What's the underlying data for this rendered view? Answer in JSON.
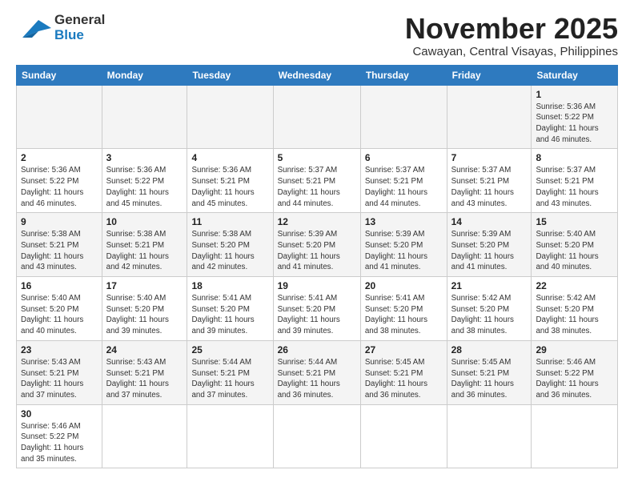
{
  "header": {
    "logo_line1": "General",
    "logo_line2": "Blue",
    "month_title": "November 2025",
    "location": "Cawayan, Central Visayas, Philippines"
  },
  "weekdays": [
    "Sunday",
    "Monday",
    "Tuesday",
    "Wednesday",
    "Thursday",
    "Friday",
    "Saturday"
  ],
  "weeks": [
    [
      {
        "day": "",
        "info": ""
      },
      {
        "day": "",
        "info": ""
      },
      {
        "day": "",
        "info": ""
      },
      {
        "day": "",
        "info": ""
      },
      {
        "day": "",
        "info": ""
      },
      {
        "day": "",
        "info": ""
      },
      {
        "day": "1",
        "info": "Sunrise: 5:36 AM\nSunset: 5:22 PM\nDaylight: 11 hours\nand 46 minutes."
      }
    ],
    [
      {
        "day": "2",
        "info": "Sunrise: 5:36 AM\nSunset: 5:22 PM\nDaylight: 11 hours\nand 46 minutes."
      },
      {
        "day": "3",
        "info": "Sunrise: 5:36 AM\nSunset: 5:22 PM\nDaylight: 11 hours\nand 45 minutes."
      },
      {
        "day": "4",
        "info": "Sunrise: 5:36 AM\nSunset: 5:21 PM\nDaylight: 11 hours\nand 45 minutes."
      },
      {
        "day": "5",
        "info": "Sunrise: 5:37 AM\nSunset: 5:21 PM\nDaylight: 11 hours\nand 44 minutes."
      },
      {
        "day": "6",
        "info": "Sunrise: 5:37 AM\nSunset: 5:21 PM\nDaylight: 11 hours\nand 44 minutes."
      },
      {
        "day": "7",
        "info": "Sunrise: 5:37 AM\nSunset: 5:21 PM\nDaylight: 11 hours\nand 43 minutes."
      },
      {
        "day": "8",
        "info": "Sunrise: 5:37 AM\nSunset: 5:21 PM\nDaylight: 11 hours\nand 43 minutes."
      }
    ],
    [
      {
        "day": "9",
        "info": "Sunrise: 5:38 AM\nSunset: 5:21 PM\nDaylight: 11 hours\nand 43 minutes."
      },
      {
        "day": "10",
        "info": "Sunrise: 5:38 AM\nSunset: 5:21 PM\nDaylight: 11 hours\nand 42 minutes."
      },
      {
        "day": "11",
        "info": "Sunrise: 5:38 AM\nSunset: 5:20 PM\nDaylight: 11 hours\nand 42 minutes."
      },
      {
        "day": "12",
        "info": "Sunrise: 5:39 AM\nSunset: 5:20 PM\nDaylight: 11 hours\nand 41 minutes."
      },
      {
        "day": "13",
        "info": "Sunrise: 5:39 AM\nSunset: 5:20 PM\nDaylight: 11 hours\nand 41 minutes."
      },
      {
        "day": "14",
        "info": "Sunrise: 5:39 AM\nSunset: 5:20 PM\nDaylight: 11 hours\nand 41 minutes."
      },
      {
        "day": "15",
        "info": "Sunrise: 5:40 AM\nSunset: 5:20 PM\nDaylight: 11 hours\nand 40 minutes."
      }
    ],
    [
      {
        "day": "16",
        "info": "Sunrise: 5:40 AM\nSunset: 5:20 PM\nDaylight: 11 hours\nand 40 minutes."
      },
      {
        "day": "17",
        "info": "Sunrise: 5:40 AM\nSunset: 5:20 PM\nDaylight: 11 hours\nand 39 minutes."
      },
      {
        "day": "18",
        "info": "Sunrise: 5:41 AM\nSunset: 5:20 PM\nDaylight: 11 hours\nand 39 minutes."
      },
      {
        "day": "19",
        "info": "Sunrise: 5:41 AM\nSunset: 5:20 PM\nDaylight: 11 hours\nand 39 minutes."
      },
      {
        "day": "20",
        "info": "Sunrise: 5:41 AM\nSunset: 5:20 PM\nDaylight: 11 hours\nand 38 minutes."
      },
      {
        "day": "21",
        "info": "Sunrise: 5:42 AM\nSunset: 5:20 PM\nDaylight: 11 hours\nand 38 minutes."
      },
      {
        "day": "22",
        "info": "Sunrise: 5:42 AM\nSunset: 5:20 PM\nDaylight: 11 hours\nand 38 minutes."
      }
    ],
    [
      {
        "day": "23",
        "info": "Sunrise: 5:43 AM\nSunset: 5:21 PM\nDaylight: 11 hours\nand 37 minutes."
      },
      {
        "day": "24",
        "info": "Sunrise: 5:43 AM\nSunset: 5:21 PM\nDaylight: 11 hours\nand 37 minutes."
      },
      {
        "day": "25",
        "info": "Sunrise: 5:44 AM\nSunset: 5:21 PM\nDaylight: 11 hours\nand 37 minutes."
      },
      {
        "day": "26",
        "info": "Sunrise: 5:44 AM\nSunset: 5:21 PM\nDaylight: 11 hours\nand 36 minutes."
      },
      {
        "day": "27",
        "info": "Sunrise: 5:45 AM\nSunset: 5:21 PM\nDaylight: 11 hours\nand 36 minutes."
      },
      {
        "day": "28",
        "info": "Sunrise: 5:45 AM\nSunset: 5:21 PM\nDaylight: 11 hours\nand 36 minutes."
      },
      {
        "day": "29",
        "info": "Sunrise: 5:46 AM\nSunset: 5:22 PM\nDaylight: 11 hours\nand 36 minutes."
      }
    ],
    [
      {
        "day": "30",
        "info": "Sunrise: 5:46 AM\nSunset: 5:22 PM\nDaylight: 11 hours\nand 35 minutes."
      },
      {
        "day": "",
        "info": ""
      },
      {
        "day": "",
        "info": ""
      },
      {
        "day": "",
        "info": ""
      },
      {
        "day": "",
        "info": ""
      },
      {
        "day": "",
        "info": ""
      },
      {
        "day": "",
        "info": ""
      }
    ]
  ]
}
